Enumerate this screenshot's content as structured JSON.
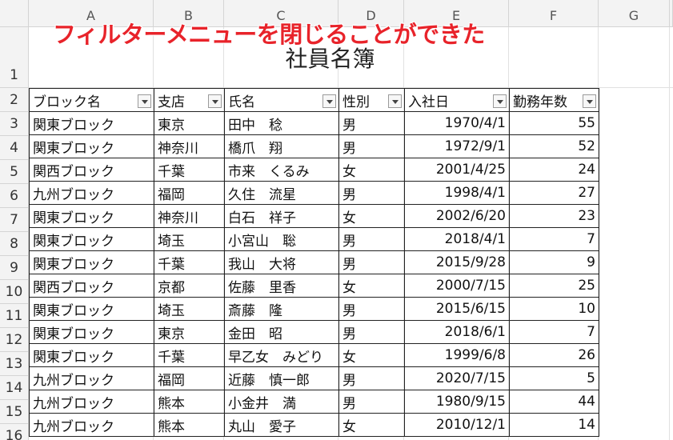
{
  "overlay_caption": "フィルターメニューを閉じることができた",
  "sheet_title": "社員名簿",
  "column_headers": [
    "A",
    "B",
    "C",
    "D",
    "E",
    "F",
    "G"
  ],
  "row_numbers": [
    "1",
    "2",
    "3",
    "4",
    "5",
    "6",
    "7",
    "8",
    "9",
    "10",
    "11",
    "12",
    "13",
    "14",
    "15",
    "16"
  ],
  "table": {
    "headers": [
      "ブロック名",
      "支店",
      "氏名",
      "性別",
      "入社日",
      "勤務年数"
    ],
    "rows": [
      [
        "関東ブロック",
        "東京",
        "田中　稔",
        "男",
        "1970/4/1",
        "55"
      ],
      [
        "関東ブロック",
        "神奈川",
        "橋爪　翔",
        "男",
        "1972/9/1",
        "52"
      ],
      [
        "関西ブロック",
        "千葉",
        "市来　くるみ",
        "女",
        "2001/4/25",
        "24"
      ],
      [
        "九州ブロック",
        "福岡",
        "久住　流星",
        "男",
        "1998/4/1",
        "27"
      ],
      [
        "関東ブロック",
        "神奈川",
        "白石　祥子",
        "女",
        "2002/6/20",
        "23"
      ],
      [
        "関東ブロック",
        "埼玉",
        "小宮山　聡",
        "男",
        "2018/4/1",
        "7"
      ],
      [
        "関東ブロック",
        "千葉",
        "我山　大将",
        "男",
        "2015/9/28",
        "9"
      ],
      [
        "関西ブロック",
        "京都",
        "佐藤　里香",
        "女",
        "2000/7/15",
        "25"
      ],
      [
        "関東ブロック",
        "埼玉",
        "斎藤　隆",
        "男",
        "2015/6/15",
        "10"
      ],
      [
        "関東ブロック",
        "東京",
        "金田　昭",
        "男",
        "2018/6/1",
        "7"
      ],
      [
        "関東ブロック",
        "千葉",
        "早乙女　みどり",
        "女",
        "1999/6/8",
        "26"
      ],
      [
        "九州ブロック",
        "福岡",
        "近藤　慎一郎",
        "男",
        "2020/7/15",
        "5"
      ],
      [
        "九州ブロック",
        "熊本",
        "小金井　満",
        "男",
        "1980/9/15",
        "44"
      ],
      [
        "九州ブロック",
        "熊本",
        "丸山　愛子",
        "女",
        "2010/12/1",
        "14"
      ]
    ]
  },
  "colors": {
    "overlay": "#e8232a",
    "header_bg": "#f3f3f3",
    "gridline": "#e1e1e1"
  }
}
